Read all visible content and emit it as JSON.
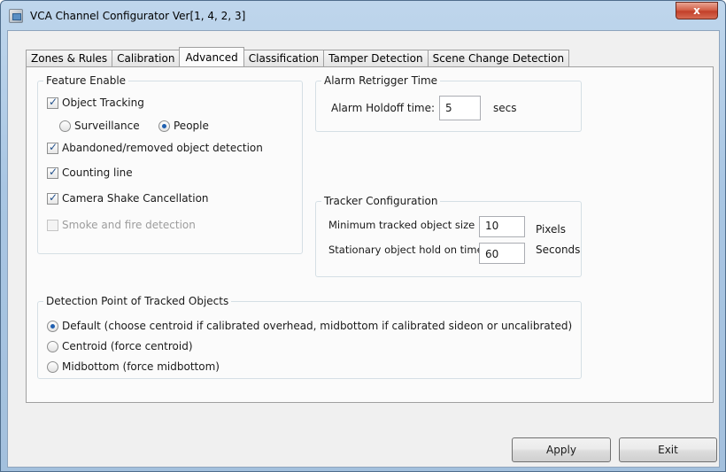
{
  "window": {
    "title": "VCA Channel Configurator Ver[1, 4, 2, 3]",
    "close_label": "x"
  },
  "tabs": [
    {
      "label": "Zones & Rules"
    },
    {
      "label": "Calibration"
    },
    {
      "label": "Advanced"
    },
    {
      "label": "Classification"
    },
    {
      "label": "Tamper Detection"
    },
    {
      "label": "Scene Change Detection"
    }
  ],
  "active_tab": "Advanced",
  "feature_enable": {
    "title": "Feature Enable",
    "object_tracking": {
      "label": "Object Tracking",
      "checked": true
    },
    "mode_options": [
      {
        "label": "Surveillance",
        "selected": false
      },
      {
        "label": "People",
        "selected": true
      }
    ],
    "abandoned": {
      "label": "Abandoned/removed object detection",
      "checked": true
    },
    "counting_line": {
      "label": "Counting line",
      "checked": true
    },
    "camera_shake": {
      "label": "Camera Shake Cancellation",
      "checked": true
    },
    "smoke_fire": {
      "label": "Smoke and fire detection",
      "checked": false,
      "disabled": true
    }
  },
  "alarm_retrigger": {
    "title": "Alarm Retrigger Time",
    "holdoff_label": "Alarm Holdoff time:",
    "holdoff_value": "5",
    "unit": "secs"
  },
  "tracker_config": {
    "title": "Tracker Configuration",
    "min_size_label": "Minimum tracked object size",
    "min_size_value": "10",
    "min_size_unit": "Pixels",
    "stationary_label": "Stationary object hold on time",
    "stationary_value": "60",
    "stationary_unit": "Seconds"
  },
  "detection_point": {
    "title": "Detection Point of Tracked Objects",
    "options": [
      {
        "label": "Default (choose centroid if calibrated overhead, midbottom if calibrated sideon or uncalibrated)",
        "selected": true
      },
      {
        "label": "Centroid (force centroid)",
        "selected": false
      },
      {
        "label": "Midbottom (force midbottom)",
        "selected": false
      }
    ]
  },
  "buttons": {
    "apply": "Apply",
    "exit": "Exit"
  }
}
